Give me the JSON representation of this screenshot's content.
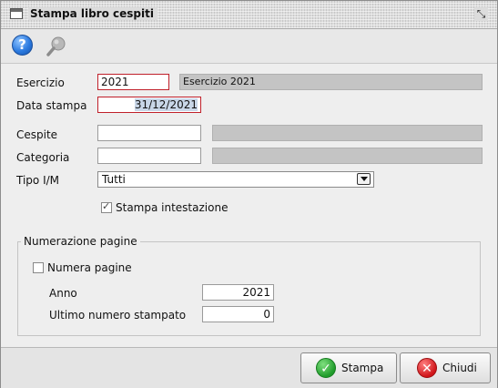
{
  "window": {
    "title": "Stampa libro cespiti"
  },
  "toolbar": {
    "help_icon": "?"
  },
  "form": {
    "esercizio_label": "Esercizio",
    "esercizio_value": "2021",
    "esercizio_desc": "Esercizio 2021",
    "data_stampa_label": "Data stampa",
    "data_stampa_value": "31/12/2021",
    "cespite_label": "Cespite",
    "cespite_value": "",
    "cespite_desc": "",
    "categoria_label": "Categoria",
    "categoria_value": "",
    "categoria_desc": "",
    "tipo_label": "Tipo I/M",
    "tipo_value": "Tutti",
    "stampa_intestazione_label": "Stampa intestazione",
    "stampa_intestazione_checked": true
  },
  "numerazione": {
    "group_title": "Numerazione pagine",
    "numera_pagine_label": "Numera pagine",
    "numera_pagine_checked": false,
    "anno_label": "Anno",
    "anno_value": "2021",
    "ultimo_label": "Ultimo numero stampato",
    "ultimo_value": "0"
  },
  "buttons": {
    "stampa_label": "Stampa",
    "chiudi_label": "Chiudi"
  },
  "colors": {
    "error_border": "#c0202a",
    "ok_green": "#1f9b2a",
    "close_red": "#d0151a"
  }
}
